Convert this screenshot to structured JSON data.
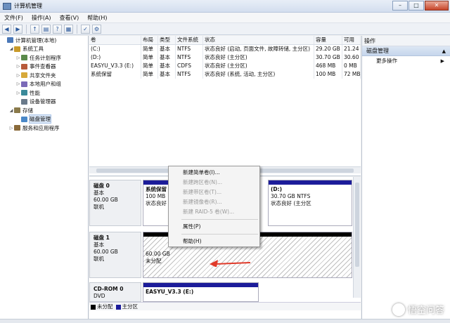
{
  "window": {
    "title": "计算机管理"
  },
  "menu": [
    "文件(F)",
    "操作(A)",
    "查看(V)",
    "帮助(H)"
  ],
  "tree": {
    "items": [
      {
        "label": "计算机管理(本地)",
        "level": 0,
        "exp": ""
      },
      {
        "label": "系统工具",
        "level": 1,
        "exp": "◢"
      },
      {
        "label": "任务计划程序",
        "level": 2,
        "exp": "▷"
      },
      {
        "label": "事件查看器",
        "level": 2,
        "exp": "▷"
      },
      {
        "label": "共享文件夹",
        "level": 2,
        "exp": "▷"
      },
      {
        "label": "本地用户和组",
        "level": 2,
        "exp": "▷"
      },
      {
        "label": "性能",
        "level": 2,
        "exp": "▷"
      },
      {
        "label": "设备管理器",
        "level": 2,
        "exp": ""
      },
      {
        "label": "存储",
        "level": 1,
        "exp": "◢"
      },
      {
        "label": "磁盘管理",
        "level": 2,
        "exp": "",
        "selected": true
      },
      {
        "label": "服务和应用程序",
        "level": 1,
        "exp": "▷"
      }
    ]
  },
  "volumes": {
    "headers": [
      "卷",
      "布局",
      "类型",
      "文件系统",
      "状态",
      "容量",
      "可用"
    ],
    "rows": [
      [
        "(C:)",
        "简单",
        "基本",
        "NTFS",
        "状态良好 (启动, 页面文件, 故障转储, 主分区)",
        "29.20 GB",
        "21.24"
      ],
      [
        "(D:)",
        "简单",
        "基本",
        "NTFS",
        "状态良好 (主分区)",
        "30.70 GB",
        "30.60"
      ],
      [
        "EASYU_V3.3 (E:)",
        "简单",
        "基本",
        "CDFS",
        "状态良好 (主分区)",
        "468 MB",
        "0 MB"
      ],
      [
        "系统保留",
        "简单",
        "基本",
        "NTFS",
        "状态良好 (系统, 活动, 主分区)",
        "100 MB",
        "72 MB"
      ]
    ]
  },
  "disks": {
    "disk0": {
      "name": "磁盘 0",
      "type": "基本",
      "size": "60.00 GB",
      "status": "联机",
      "part1": {
        "name": "系统保留",
        "size": "100 MB",
        "status": "状态良好"
      },
      "part2": {
        "name": "(D:)",
        "size": "30.70 GB NTFS",
        "status": "状态良好 (主分区"
      }
    },
    "disk1": {
      "name": "磁盘 1",
      "type": "基本",
      "size": "60.00 GB",
      "status": "联机",
      "part1": {
        "size": "60.00 GB",
        "status": "未分配"
      }
    },
    "cdrom0": {
      "name": "CD-ROM 0",
      "type": "DVD",
      "part1": {
        "name": "EASYU_V3.3 (E:)"
      }
    }
  },
  "legend": {
    "unallocated": "未分配",
    "primary": "主分区"
  },
  "context_menu": [
    {
      "label": "新建简单卷(I)...",
      "enabled": true
    },
    {
      "label": "新建跨区卷(N)...",
      "enabled": false
    },
    {
      "label": "新建带区卷(T)...",
      "enabled": false
    },
    {
      "label": "新建镜像卷(R)...",
      "enabled": false
    },
    {
      "label": "新建 RAID-5 卷(W)...",
      "enabled": false
    },
    {
      "label": "属性(P)",
      "enabled": true
    },
    {
      "label": "帮助(H)",
      "enabled": true
    }
  ],
  "actions": {
    "header": "操作",
    "section": "磁盘管理",
    "more": "更多操作"
  },
  "watermark": "悟空问答",
  "colors": {
    "primary_partition": "#1c1c9a",
    "unallocated": "#000000",
    "arrow": "#e03a2a"
  }
}
